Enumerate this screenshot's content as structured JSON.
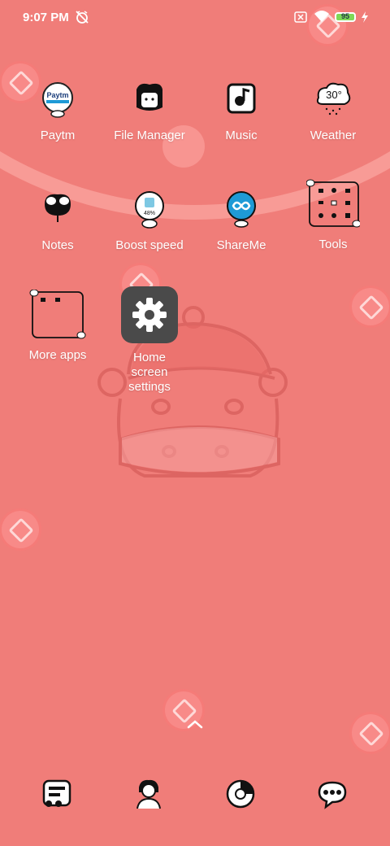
{
  "status_bar": {
    "time": "9:07 PM",
    "battery_level": "95",
    "icons": [
      "alarm-off-icon",
      "sim-x-icon",
      "wifi-icon",
      "battery-icon",
      "charging-icon"
    ]
  },
  "apps": {
    "paytm": "Paytm",
    "file_manager": "File Manager",
    "music": "Music",
    "weather": "Weather",
    "weather_temp": "30°",
    "notes": "Notes",
    "boost": "Boost speed",
    "boost_pct": "48%",
    "shareme": "ShareMe",
    "tools": "Tools",
    "more_apps": "More apps",
    "home_settings": "Home screen settings"
  },
  "dock": [
    "messages-icon",
    "contacts-icon",
    "browser-icon",
    "chat-icon"
  ],
  "colors": {
    "background": "#f07d79",
    "settings_tile": "#4a4a4a",
    "battery": "#7ed957",
    "shareme": "#1e9ad6"
  }
}
